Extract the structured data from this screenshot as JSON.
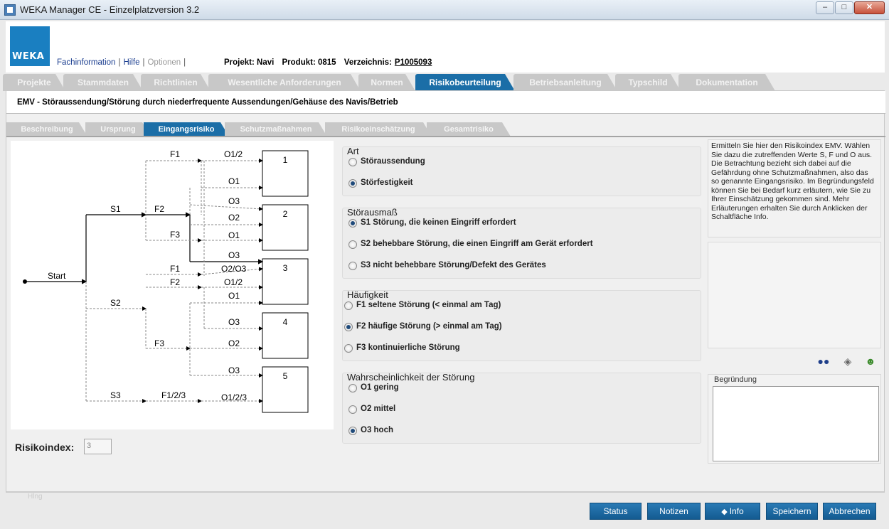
{
  "window": {
    "title": "WEKA Manager CE - Einzelplatzversion 3.2",
    "min": "‒",
    "max": "□",
    "close": "✕"
  },
  "header": {
    "logo": "WEKA",
    "links": [
      "Fachinformation",
      "Hilfe",
      "Optionen"
    ],
    "project_label": "Projekt: Navi",
    "product_label": "Produkt: 0815",
    "directory_label": "Verzeichnis:",
    "directory_value": "P1005093"
  },
  "main_tabs": [
    "Projekte",
    "Stammdaten",
    "Richtlinien",
    "Wesentliche Anforderungen",
    "Normen",
    "Risikobeurteilung",
    "Betriebsanleitung",
    "Typschild",
    "Dokumentation"
  ],
  "section_title": "EMV - Störaussendung/Störung durch niederfrequente Aussendungen/Gehäuse des Navis/Betrieb",
  "sub_tabs": [
    "Beschreibung",
    "Ursprung",
    "Eingangsrisiko",
    "Schutzmaßnahmen",
    "Risikoeinschätzung",
    "Gesamtrisiko"
  ],
  "diagram": {
    "start": "Start",
    "s_labels": [
      "S1",
      "S2",
      "S3"
    ],
    "f_labels": [
      "F1",
      "F2",
      "F3",
      "F1",
      "F2",
      "F3",
      "F1/2/3"
    ],
    "o_labels": [
      "O1/2",
      "O1",
      "O3",
      "O2",
      "O1",
      "O3",
      "O2/O3",
      "O1/2",
      "O1",
      "O3",
      "O2",
      "O3",
      "O1/2/3"
    ],
    "boxes": [
      "1",
      "2",
      "3",
      "4",
      "5"
    ]
  },
  "risk_index": {
    "label": "Risikoindex:",
    "value": "3"
  },
  "faded_label": "Hlng",
  "groups": {
    "art": {
      "title": "Art",
      "options": [
        "Störaussendung",
        "Störfestigkeit"
      ],
      "selected": 1
    },
    "ausmass": {
      "title": "Störausmaß",
      "options": [
        "S1 Störung, die keinen Eingriff erfordert",
        "S2 behebbare Störung, die einen Eingriff am Gerät erfordert",
        "S3 nicht behebbare Störung/Defekt des Gerätes"
      ],
      "selected": 0
    },
    "haeufigkeit": {
      "title": "Häufigkeit",
      "options": [
        "F1 seltene Störung (< einmal am Tag)",
        "F2 häufige Störung (> einmal am Tag)",
        "F3 kontinuierliche Störung"
      ],
      "selected": 1
    },
    "wahrscheinlichkeit": {
      "title": "Wahrscheinlichkeit der Störung",
      "options": [
        "O1 gering",
        "O2 mittel",
        "O3 hoch"
      ],
      "selected": 2
    }
  },
  "help_text": "Ermitteln Sie hier den Risikoindex EMV. Wählen Sie dazu die zutreffenden Werte S, F und O aus. Die Betrachtung bezieht sich dabei auf die Gefährdung ohne Schutzmaßnahmen, also das so genannte Eingangsrisiko. Im Begründungsfeld können Sie bei Bedarf kurz erläutern, wie Sie zu Ihrer Einschätzung gekommen sind. Mehr Erläuterungen erhalten Sie durch Anklicken der Schaltfläche Info.",
  "icons": [
    "binoculars-icon",
    "eraser-icon",
    "people-icon"
  ],
  "begruendung": {
    "label": "Begründung",
    "value": ""
  },
  "buttons": {
    "status": "Status",
    "notizen": "Notizen",
    "info": "Info",
    "speichern": "Speichern",
    "abbrechen": "Abbrechen"
  }
}
